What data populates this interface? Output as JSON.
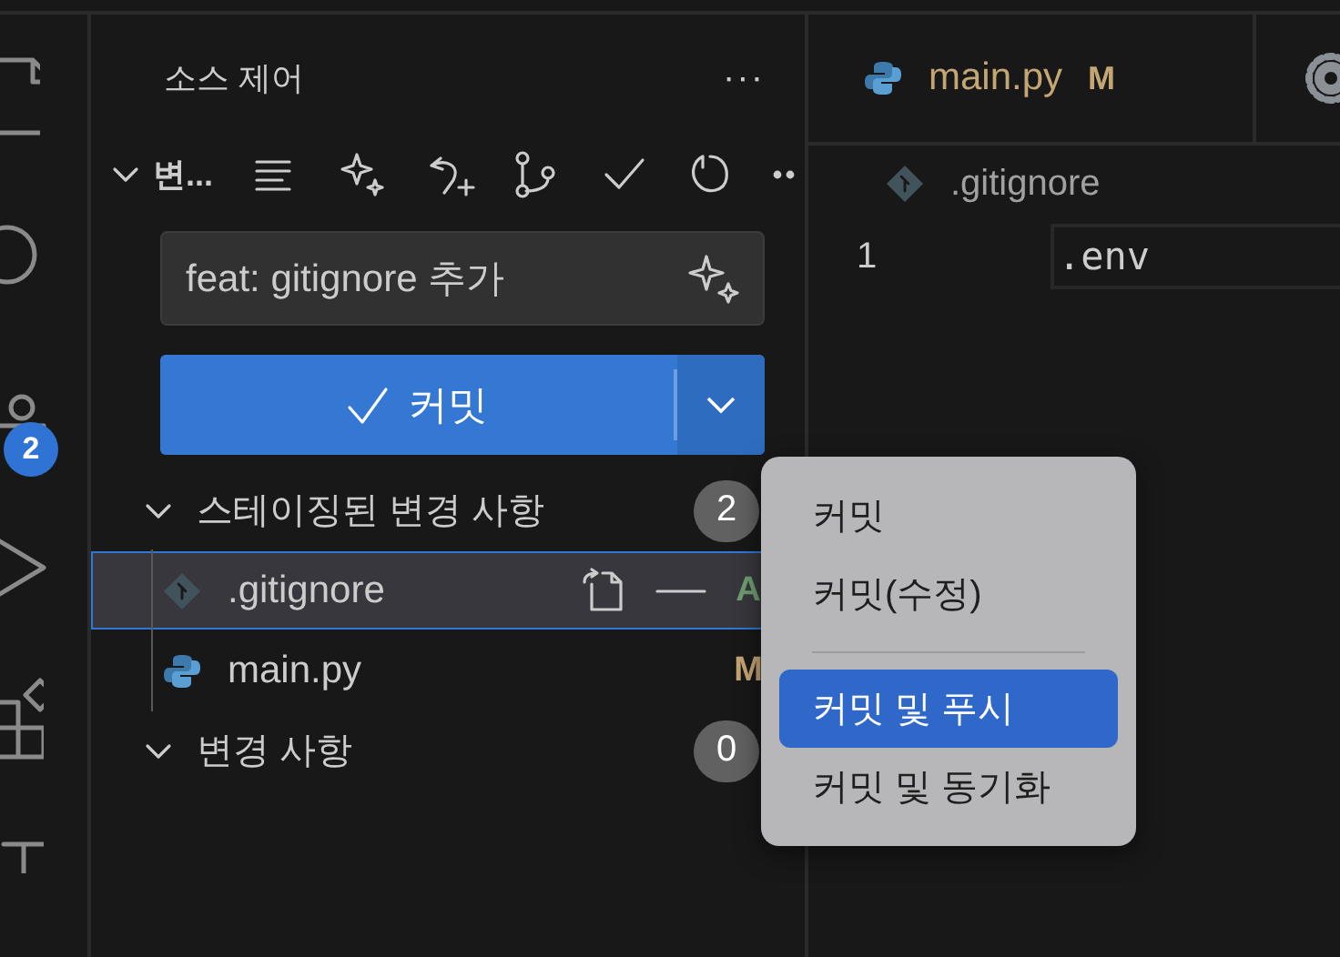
{
  "activity_bar": {
    "badge": "2"
  },
  "sidebar": {
    "title": "소스 제어",
    "more": "···",
    "repo": {
      "label": "변...",
      "expanded": true
    },
    "commit_message": {
      "value": "feat: gitignore 추가"
    },
    "commit_button": {
      "label": "커밋"
    },
    "groups": [
      {
        "label": "스테이징된 변경 사항",
        "expanded": true,
        "count": "2",
        "files": [
          {
            "name": ".gitignore",
            "status": "A",
            "selected": true
          },
          {
            "name": "main.py",
            "status": "M",
            "selected": false
          }
        ]
      },
      {
        "label": "변경 사항",
        "expanded": true,
        "count": "0"
      }
    ]
  },
  "editor": {
    "tabs": [
      {
        "label": "main.py",
        "status": "M"
      }
    ],
    "breadcrumb": ".gitignore",
    "lines": [
      {
        "number": "1",
        "text": ".env"
      }
    ]
  },
  "context_menu": [
    {
      "kind": "item",
      "label": "커밋",
      "selected": false
    },
    {
      "kind": "item",
      "label": "커밋(수정)",
      "selected": false
    },
    {
      "kind": "separator"
    },
    {
      "kind": "item",
      "label": "커밋 및 푸시",
      "selected": true
    },
    {
      "kind": "item",
      "label": "커밋 및 동기화",
      "selected": false
    }
  ]
}
